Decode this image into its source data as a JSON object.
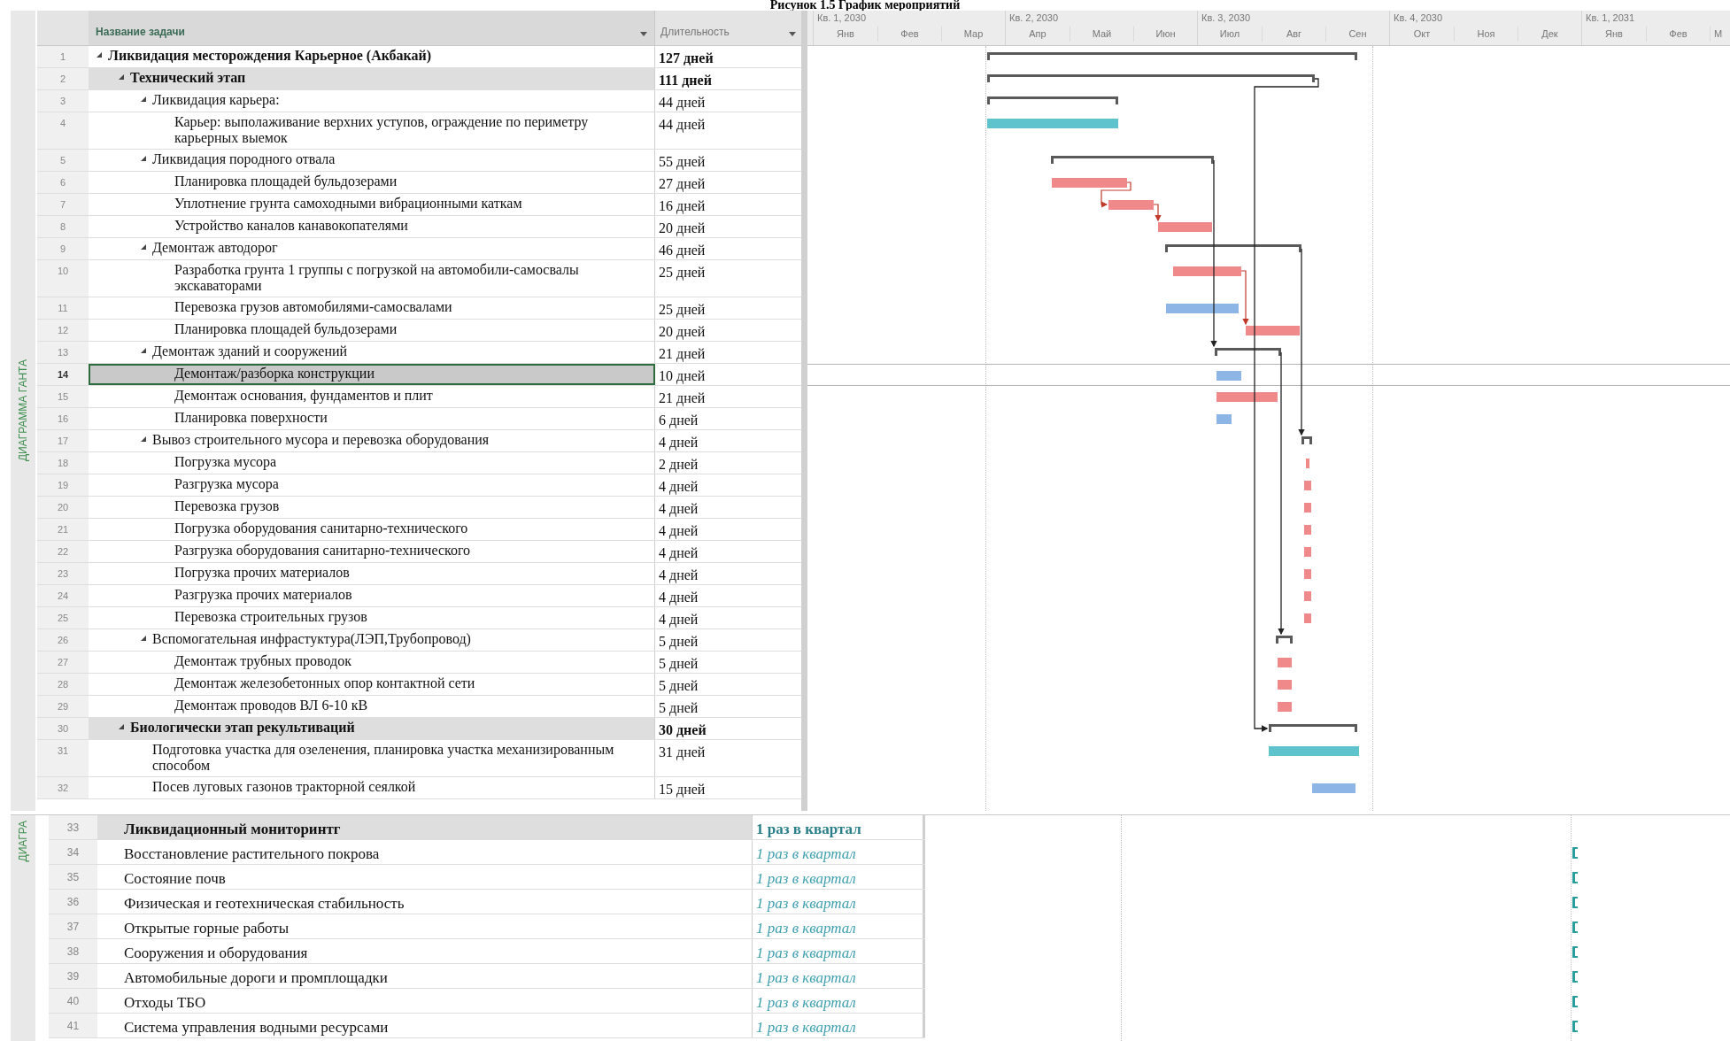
{
  "caption": "Рисунок 1.5 График мероприятий",
  "side_label": "ДИАГРАММА ГАНТА",
  "columns": [
    {
      "label": "Название задачи"
    },
    {
      "label": "Длительность"
    }
  ],
  "timescale": [
    {
      "label": "Кв. 1, 2030",
      "months": [
        "Янв",
        "Фев",
        "Мар"
      ]
    },
    {
      "label": "Кв. 2, 2030",
      "months": [
        "Апр",
        "Май",
        "Июн"
      ]
    },
    {
      "label": "Кв. 3, 2030",
      "months": [
        "Июл",
        "Авг",
        "Сен"
      ]
    },
    {
      "label": "Кв. 4, 2030",
      "months": [
        "Окт",
        "Ноя",
        "Дек"
      ]
    },
    {
      "label": "Кв. 1, 2031",
      "months": [
        "Янв",
        "Фев",
        "М"
      ]
    }
  ],
  "tasks": [
    {
      "id": "1",
      "name": "Ликвидация месторождения  Карьерное (Акбакай)",
      "duration": "127 дней",
      "expanded": true,
      "selected": false,
      "children": [
        {
          "id": "2",
          "name": "Технический этап",
          "duration": "111 дней",
          "expanded": true,
          "selected": false,
          "children": [
            {
              "id": "3",
              "name": "Ликвидация карьера:",
              "duration": "44 дней",
              "expanded": true,
              "selected": false,
              "children": [
                {
                  "id": "4",
                  "name": "Карьер: выполаживание верхних уступов, ограждение по периметру карьерных выемок",
                  "duration": "44 дней",
                  "selected": false,
                  "color": "#5ec3cc"
                }
              ]
            },
            {
              "id": "5",
              "name": "Ликвидация породного отвала",
              "duration": "55 дней",
              "expanded": true,
              "selected": false,
              "children": [
                {
                  "id": "6",
                  "name": "Планировка площадей бульдозерами",
                  "duration": "27 дней",
                  "selected": false,
                  "color": "#f08a8a"
                },
                {
                  "id": "7",
                  "name": "Уплотнение грунта самоходными вибрационными каткам",
                  "duration": "16 дней",
                  "selected": false,
                  "color": "#f08a8a"
                },
                {
                  "id": "8",
                  "name": "Устройство каналов канавокопателями",
                  "duration": "20 дней",
                  "selected": false,
                  "color": "#f08a8a"
                }
              ]
            },
            {
              "id": "9",
              "name": "Демонтаж автодорог",
              "duration": "46 дней",
              "expanded": true,
              "selected": false,
              "children": [
                {
                  "id": "10",
                  "name": "Разработка грунта 1 группы с погрузкой на автомобили-самосвалы экскаваторами",
                  "duration": "25 дней",
                  "selected": false,
                  "color": "#f08a8a"
                },
                {
                  "id": "11",
                  "name": "Перевозка грузов автомобилями-самосвалами",
                  "duration": "25 дней",
                  "selected": false,
                  "color": "#8db6e6"
                },
                {
                  "id": "12",
                  "name": "Планировка площадей бульдозерами",
                  "duration": "20 дней",
                  "selected": false,
                  "color": "#f08a8a"
                }
              ]
            },
            {
              "id": "13",
              "name": "Демонтаж зданий и сооружений",
              "duration": "21 дней",
              "expanded": true,
              "selected": false,
              "children": [
                {
                  "id": "14",
                  "name": "Демонтаж/разборка конструкции",
                  "duration": "10 дней",
                  "selected": true,
                  "color": "#8db6e6"
                },
                {
                  "id": "15",
                  "name": "Демонтаж основания, фундаментов и плит",
                  "duration": "21 дней",
                  "selected": false,
                  "color": "#f08a8a"
                },
                {
                  "id": "16",
                  "name": "Планировка поверхности",
                  "duration": "6 дней",
                  "selected": false,
                  "color": "#8db6e6"
                }
              ]
            },
            {
              "id": "17",
              "name": "Вывоз строительного мусора и перевозка оборудования",
              "duration": "4 дней",
              "expanded": true,
              "selected": false,
              "children": [
                {
                  "id": "18",
                  "name": "Погрузка мусора",
                  "duration": "2 дней",
                  "selected": false,
                  "color": "#f08a8a"
                },
                {
                  "id": "19",
                  "name": "Разгрузка мусора",
                  "duration": "4 дней",
                  "selected": false,
                  "color": "#f08a8a"
                },
                {
                  "id": "20",
                  "name": "Перевозка грузов",
                  "duration": "4 дней",
                  "selected": false,
                  "color": "#f08a8a"
                },
                {
                  "id": "21",
                  "name": "Погрузка оборудования санитарно-технического",
                  "duration": "4 дней",
                  "selected": false,
                  "color": "#f08a8a"
                },
                {
                  "id": "22",
                  "name": "Разгрузка оборудования санитарно-технического",
                  "duration": "4 дней",
                  "selected": false,
                  "color": "#f08a8a"
                },
                {
                  "id": "23",
                  "name": "Погрузка прочих материалов",
                  "duration": "4 дней",
                  "selected": false,
                  "color": "#f08a8a"
                },
                {
                  "id": "24",
                  "name": "Разгрузка прочих материалов",
                  "duration": "4 дней",
                  "selected": false,
                  "color": "#f08a8a"
                },
                {
                  "id": "25",
                  "name": "Перевозка строительных грузов",
                  "duration": "4 дней",
                  "selected": false,
                  "color": "#f08a8a"
                }
              ]
            },
            {
              "id": "26",
              "name": "Вспомогательная инфрастуктура(ЛЭП,Трубопровод)",
              "duration": "5 дней",
              "expanded": true,
              "selected": false,
              "children": [
                {
                  "id": "27",
                  "name": "Демонтаж трубных проводок",
                  "duration": "5 дней",
                  "selected": false,
                  "color": "#f08a8a"
                },
                {
                  "id": "28",
                  "name": "Демонтаж железобетонных опор контактной сети",
                  "duration": "5 дней",
                  "selected": false,
                  "color": "#f08a8a"
                },
                {
                  "id": "29",
                  "name": "Демонтаж проводов ВЛ 6-10 кВ",
                  "duration": "5 дней",
                  "selected": false,
                  "color": "#f08a8a"
                }
              ]
            }
          ]
        },
        {
          "id": "30",
          "name": "Биологически этап рекультиваций",
          "duration": "30 дней",
          "expanded": true,
          "selected": false,
          "children": [
            {
              "id": "31",
              "name": "Подготовка участка для озеленения, планировка участка механизированным способом",
              "duration": "31 дней",
              "selected": false,
              "color": "#5ec3cc"
            },
            {
              "id": "32",
              "name": "Посев луговых газонов тракторной сеялкой",
              "duration": "15 дней",
              "selected": false,
              "color": "#8db6e6"
            }
          ]
        }
      ]
    }
  ],
  "monitoring": {
    "side_label": "ДИАГРА",
    "rows": [
      {
        "id": "33",
        "name": "Ликвидационный мониторинтг",
        "duration": "1 раз в квартал",
        "kind": "summary"
      },
      {
        "id": "34",
        "name": "Восстановление растительного покрова",
        "duration": "1 раз в квартал",
        "kind": "task"
      },
      {
        "id": "35",
        "name": "Состояние почв",
        "duration": "1 раз в квартал",
        "kind": "task"
      },
      {
        "id": "36",
        "name": "Физическая и геотехническая стабильность",
        "duration": "1 раз в квартал",
        "kind": "task"
      },
      {
        "id": "37",
        "name": "Открытые горные работы",
        "duration": "1 раз в квартал",
        "kind": "task"
      },
      {
        "id": "38",
        "name": "Сооружения и оборудования",
        "duration": "1 раз в квартал",
        "kind": "task"
      },
      {
        "id": "39",
        "name": "Автомобильные дороги и промплощадки",
        "duration": "1 раз в квартал",
        "kind": "task"
      },
      {
        "id": "40",
        "name": "Отходы ТБО",
        "duration": "1 раз в квартал",
        "kind": "task"
      },
      {
        "id": "41",
        "name": "Система управления водными ресурсами",
        "duration": "1 раз в квартал",
        "kind": "task"
      }
    ]
  }
}
